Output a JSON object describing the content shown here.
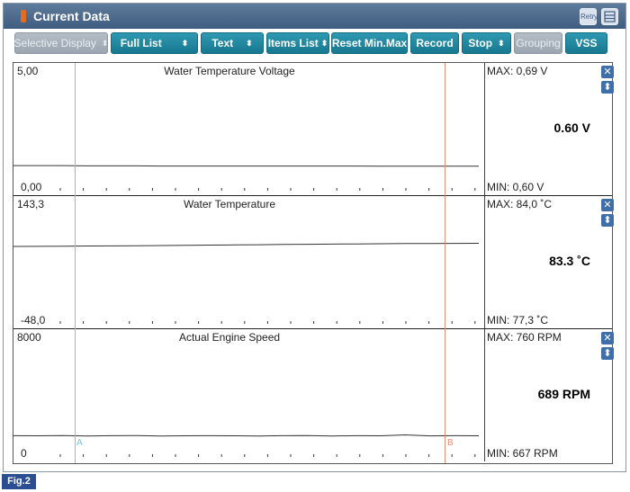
{
  "window": {
    "title": "Current Data",
    "retry_label": "Retry"
  },
  "toolbar": {
    "buttons": [
      {
        "label": "Selective Display",
        "state": "disabled",
        "has_arrow": true
      },
      {
        "label": "Full List",
        "state": "active",
        "has_arrow": true
      },
      {
        "label": "Text",
        "state": "active",
        "has_arrow": true
      },
      {
        "label": "Items List",
        "state": "active",
        "has_arrow": true
      },
      {
        "label": "Reset Min.Max",
        "state": "active",
        "has_arrow": false
      },
      {
        "label": "Record",
        "state": "active",
        "has_arrow": false
      },
      {
        "label": "Stop",
        "state": "active",
        "has_arrow": true
      },
      {
        "label": "Grouping",
        "state": "disabled",
        "has_arrow": false
      },
      {
        "label": "VSS",
        "state": "active",
        "has_arrow": false
      }
    ]
  },
  "panels": [
    {
      "title": "Water Temperature Voltage",
      "y_max": "5,00",
      "y_min": "0,00",
      "max": "MAX:  0,69 V",
      "min": "MIN:  0,60 V",
      "current": "0.60 V",
      "series": [
        0.63,
        0.63,
        0.63,
        0.62,
        0.62,
        0.62,
        0.61,
        0.61,
        0.61,
        0.61,
        0.61,
        0.61,
        0.61,
        0.61,
        0.61,
        0.6,
        0.6,
        0.6,
        0.6,
        0.6
      ]
    },
    {
      "title": "Water Temperature",
      "y_max": "143,3",
      "y_min": "-48,0",
      "max": "MAX:  84,0 ˚C",
      "min": "MIN:  77,3 ˚C",
      "current": "83.3 ˚C",
      "series": [
        77.3,
        77.4,
        77.6,
        78.0,
        78.3,
        78.6,
        79.0,
        79.4,
        79.8,
        80.2,
        80.6,
        81.0,
        81.4,
        81.8,
        82.1,
        82.5,
        82.8,
        83.0,
        83.2,
        83.3
      ]
    },
    {
      "title": "Actual Engine Speed",
      "y_max": "8000",
      "y_min": "0",
      "max": "MAX:   760 RPM",
      "min": "MIN:   667 RPM",
      "current": "689 RPM",
      "series": [
        700,
        690,
        710,
        680,
        695,
        705,
        672,
        688,
        700,
        690,
        667,
        695,
        710,
        680,
        700,
        690,
        760,
        685,
        700,
        689
      ]
    }
  ],
  "cursors": {
    "a_label": "A",
    "b_label": "B"
  },
  "figure_label": "Fig.2",
  "colors": {
    "accent": "#17788f",
    "cursor_a": "#6ec9e3",
    "cursor_b": "#e88d72"
  }
}
